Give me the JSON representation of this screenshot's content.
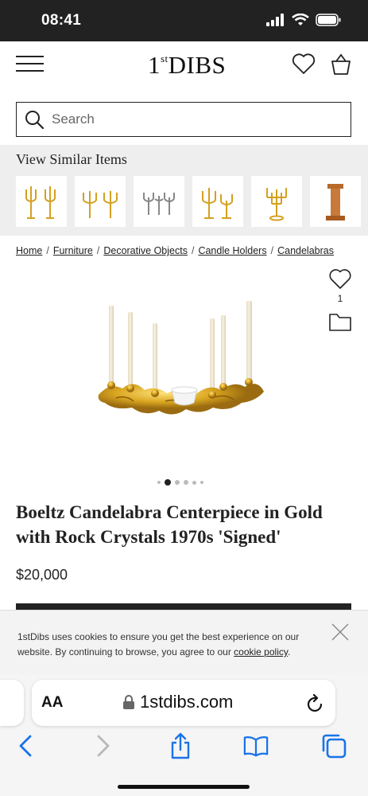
{
  "status_bar": {
    "time": "08:41"
  },
  "header": {
    "logo_main": "DIBS",
    "logo_prefix": "1",
    "logo_suffix": "st"
  },
  "search": {
    "placeholder": "Search"
  },
  "similar": {
    "title": "View Similar Items",
    "items": [
      "gold-candelabra-pair-1",
      "gold-candelabra-pair-2",
      "silver-candelabra-set",
      "gold-candelabra-pair-3",
      "gold-candelabra-single",
      "wooden-column-item"
    ]
  },
  "breadcrumb": {
    "items": [
      "Home",
      "Furniture",
      "Decorative Objects",
      "Candle Holders",
      "Candelabras"
    ],
    "separator": "/"
  },
  "product": {
    "favorite_count": "1",
    "title": "Boeltz Candelabra Centerpiece in Gold with Rock Crystals 1970s 'Signed'",
    "price": "$20,000",
    "image_count": 6,
    "active_image": 1
  },
  "cookie": {
    "text": "1stDibs uses cookies to ensure you get the best experience on our website. By continuing to browse, you agree to our ",
    "link": "cookie policy",
    "end": "."
  },
  "browser": {
    "aa": "AA",
    "url": "1stdibs.com"
  },
  "colors": {
    "status_bg": "#222222",
    "similar_bg": "#eeeeee",
    "ios_blue": "#1a73e8",
    "gold": "#d9a520"
  }
}
